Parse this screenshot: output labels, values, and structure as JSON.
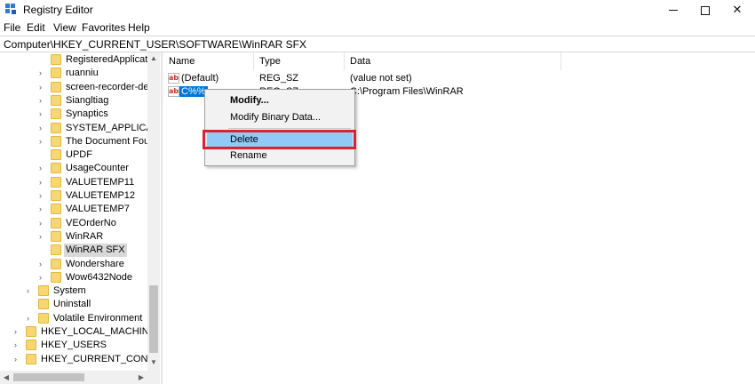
{
  "window": {
    "title": "Registry Editor",
    "icon": "registry-editor-icon",
    "controls": [
      "minimize-icon",
      "maximize-icon",
      "close-icon"
    ]
  },
  "menubar": {
    "items": [
      "File",
      "Edit",
      "View",
      "Favorites",
      "Help"
    ]
  },
  "address": {
    "path": "Computer\\HKEY_CURRENT_USER\\SOFTWARE\\WinRAR SFX"
  },
  "tree": {
    "items": [
      {
        "label": "RegisteredApplicatio",
        "level": 3,
        "expander": false,
        "selected": false
      },
      {
        "label": "ruanniu",
        "level": 3,
        "expander": true,
        "selected": false
      },
      {
        "label": "screen-recorder-dev",
        "level": 3,
        "expander": true,
        "selected": false
      },
      {
        "label": "Siangltiag",
        "level": 3,
        "expander": true,
        "selected": false
      },
      {
        "label": "Synaptics",
        "level": 3,
        "expander": true,
        "selected": false
      },
      {
        "label": "SYSTEM_APPLICATIO",
        "level": 3,
        "expander": true,
        "selected": false
      },
      {
        "label": "The Document Foun",
        "level": 3,
        "expander": true,
        "selected": false
      },
      {
        "label": "UPDF",
        "level": 3,
        "expander": false,
        "selected": false
      },
      {
        "label": "UsageCounter",
        "level": 3,
        "expander": true,
        "selected": false
      },
      {
        "label": "VALUETEMP11",
        "level": 3,
        "expander": true,
        "selected": false
      },
      {
        "label": "VALUETEMP12",
        "level": 3,
        "expander": true,
        "selected": false
      },
      {
        "label": "VALUETEMP7",
        "level": 3,
        "expander": true,
        "selected": false
      },
      {
        "label": "VEOrderNo",
        "level": 3,
        "expander": true,
        "selected": false
      },
      {
        "label": "WinRAR",
        "level": 3,
        "expander": true,
        "selected": false
      },
      {
        "label": "WinRAR SFX",
        "level": 3,
        "expander": false,
        "selected": true
      },
      {
        "label": "Wondershare",
        "level": 3,
        "expander": true,
        "selected": false
      },
      {
        "label": "Wow6432Node",
        "level": 3,
        "expander": true,
        "selected": false
      },
      {
        "label": "System",
        "level": 2,
        "expander": true,
        "selected": false
      },
      {
        "label": "Uninstall",
        "level": 2,
        "expander": false,
        "selected": false
      },
      {
        "label": "Volatile Environment",
        "level": 2,
        "expander": true,
        "selected": false
      },
      {
        "label": "HKEY_LOCAL_MACHINE",
        "level": 1,
        "expander": true,
        "selected": false
      },
      {
        "label": "HKEY_USERS",
        "level": 1,
        "expander": true,
        "selected": false
      },
      {
        "label": "HKEY_CURRENT_CONFIG",
        "level": 1,
        "expander": true,
        "selected": false
      }
    ]
  },
  "list": {
    "columns": [
      "Name",
      "Type",
      "Data"
    ],
    "rows": [
      {
        "name": "(Default)",
        "type": "REG_SZ",
        "data": "(value not set)",
        "selected": false
      },
      {
        "name": "C%%",
        "type": "REG_SZ",
        "data": "C:\\Program Files\\WinRAR",
        "selected": true
      }
    ]
  },
  "context_menu": {
    "items": [
      "Modify...",
      "Modify Binary Data...",
      "Delete",
      "Rename"
    ],
    "hovered": "Delete"
  },
  "colors": {
    "selection": "#0078d7",
    "menu_hover": "#91c9f7",
    "highlight_border": "#e0202c",
    "folder": "#f7d774"
  }
}
